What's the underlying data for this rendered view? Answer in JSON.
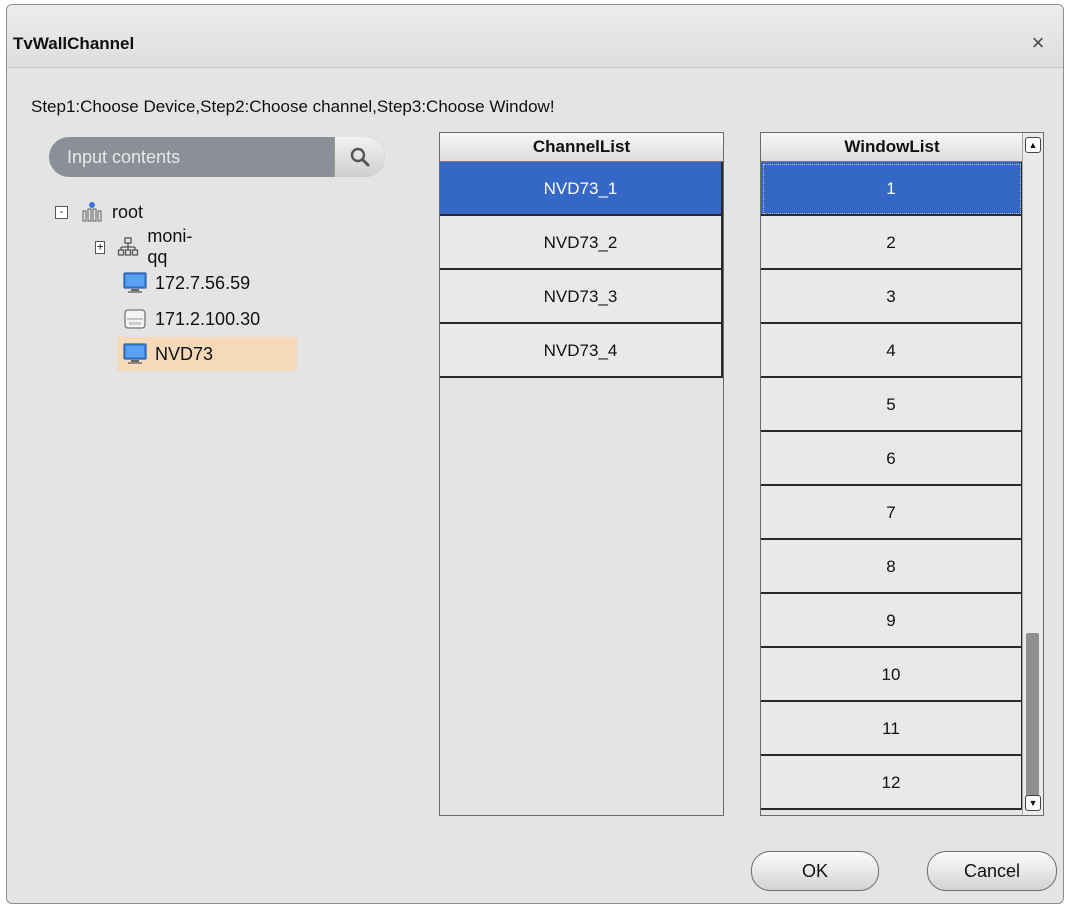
{
  "dialog": {
    "title": "TvWallChannel",
    "close_glyph": "×",
    "instructions": "Step1:Choose Device,Step2:Choose channel,Step3:Choose Window!"
  },
  "search": {
    "placeholder": "Input contents",
    "icon": "search-icon"
  },
  "tree": {
    "root": {
      "label": "root",
      "toggle": "-",
      "icon": "organization-icon"
    },
    "items": [
      {
        "label": "moni-qq",
        "toggle": "+",
        "icon": "network-icon"
      },
      {
        "label": "172.7.56.59",
        "icon": "monitor-icon"
      },
      {
        "label": "171.2.100.30",
        "icon": "storage-icon"
      },
      {
        "label": "NVD73",
        "icon": "monitor-icon",
        "selected": true
      }
    ]
  },
  "channel_list": {
    "header": "ChannelList",
    "items": [
      "NVD73_1",
      "NVD73_2",
      "NVD73_3",
      "NVD73_4"
    ],
    "selected_index": 0
  },
  "window_list": {
    "header": "WindowList",
    "items": [
      "1",
      "2",
      "3",
      "4",
      "5",
      "6",
      "7",
      "8",
      "9",
      "10",
      "11",
      "12"
    ],
    "selected_index": 0,
    "scroll_up": "▲",
    "scroll_down": "▼"
  },
  "buttons": {
    "ok": "OK",
    "cancel": "Cancel"
  },
  "colors": {
    "selection_blue": "#3568c6",
    "tree_highlight": "#f5d9b8"
  }
}
